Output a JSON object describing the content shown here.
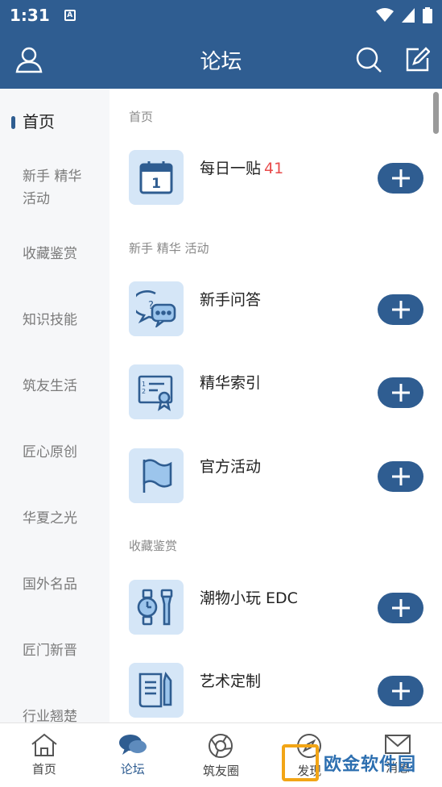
{
  "status_bar": {
    "time": "1:31",
    "sim_label": "A"
  },
  "header": {
    "title": "论坛"
  },
  "sidebar": {
    "items": [
      {
        "label": "首页",
        "active": true
      },
      {
        "label": "新手 精华\n活动"
      },
      {
        "label": "收藏鉴赏"
      },
      {
        "label": "知识技能"
      },
      {
        "label": "筑友生活"
      },
      {
        "label": "匠心原创"
      },
      {
        "label": "华夏之光"
      },
      {
        "label": "国外名品"
      },
      {
        "label": "匠门新晋"
      },
      {
        "label": "行业翘楚"
      }
    ]
  },
  "main": {
    "sections": [
      {
        "title": "首页"
      },
      {
        "title": "新手 精华 活动"
      },
      {
        "title": "收藏鉴赏"
      }
    ],
    "forums": [
      {
        "name": "每日一贴",
        "count": "41",
        "icon": "calendar-icon"
      },
      {
        "name": "新手问答",
        "icon": "chat-bubbles-icon"
      },
      {
        "name": "精华索引",
        "icon": "certificate-icon"
      },
      {
        "name": "官方活动",
        "icon": "flag-icon"
      },
      {
        "name": "潮物小玩 EDC",
        "icon": "watch-flashlight-icon"
      },
      {
        "name": "艺术定制",
        "icon": "document-pen-icon"
      }
    ]
  },
  "tabbar": {
    "tabs": [
      {
        "label": "首页",
        "icon": "home-icon"
      },
      {
        "label": "论坛",
        "icon": "chat-icon",
        "active": true
      },
      {
        "label": "筑友圈",
        "icon": "aperture-icon"
      },
      {
        "label": "发现",
        "icon": "compass-icon"
      },
      {
        "label": "消息",
        "icon": "mail-icon"
      }
    ]
  },
  "watermark": {
    "text": "欧金软件园"
  },
  "colors": {
    "primary": "#2f5d91",
    "icon_bg": "#d5e6f7",
    "count_red": "#e84b4b"
  }
}
